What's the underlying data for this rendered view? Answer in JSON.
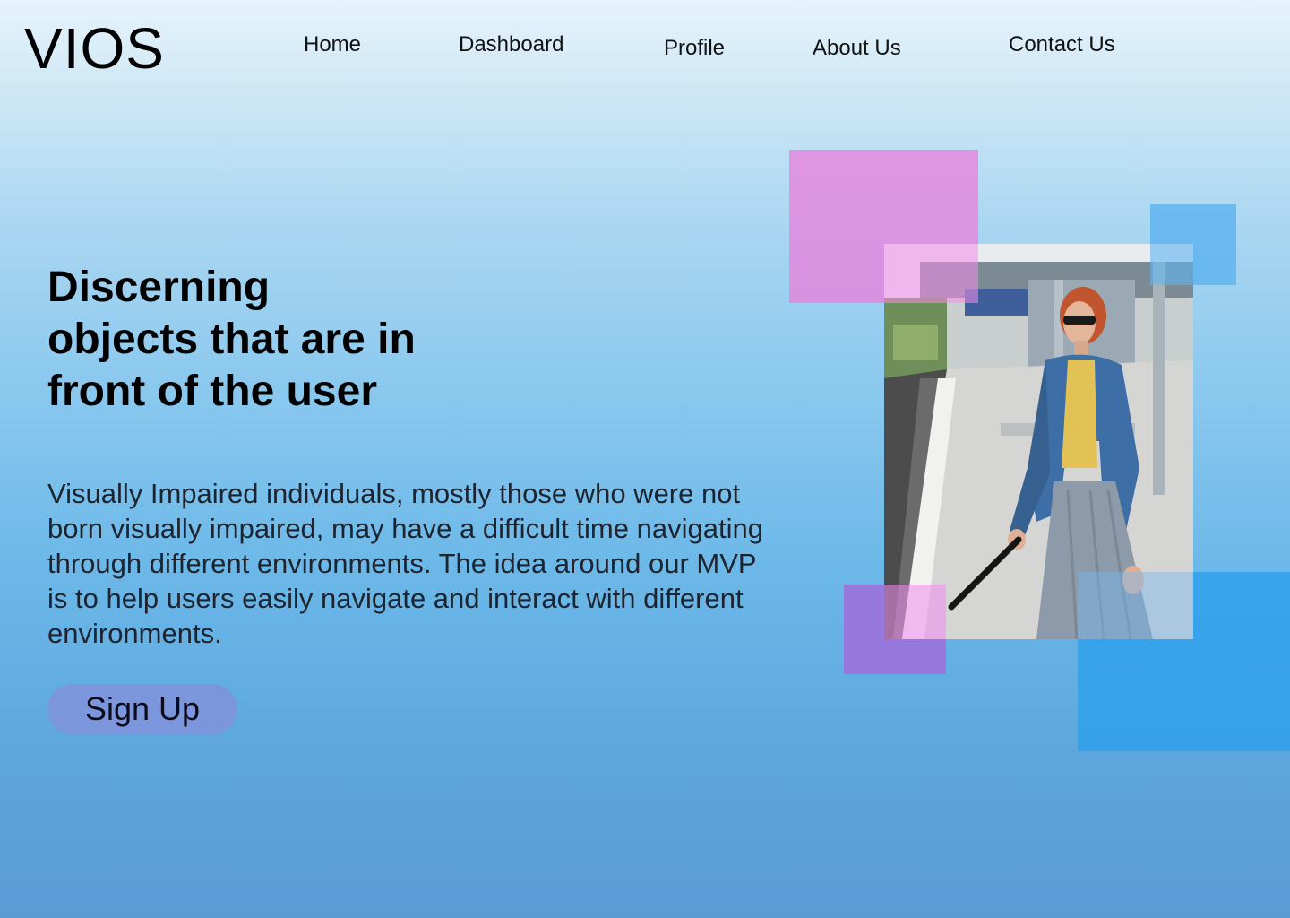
{
  "brand": {
    "logo": "VIOS"
  },
  "nav": {
    "home": "Home",
    "dashboard": "Dashboard",
    "profile": "Profile",
    "about": "About Us",
    "contact": "Contact Us"
  },
  "hero": {
    "title": "Discerning objects that are in front of the user",
    "description": "Visually Impaired individuals, mostly those who were not born visually impaired, may have a difficult time navigating through different environments. The idea around our MVP is to help users easily navigate and interact with different environments.",
    "cta_label": "Sign Up"
  },
  "colors": {
    "cta_bg": "#7b96dd",
    "accent_pink": "#e882dc",
    "accent_blue": "#5fb4f0",
    "accent_purple": "#a06edc"
  }
}
